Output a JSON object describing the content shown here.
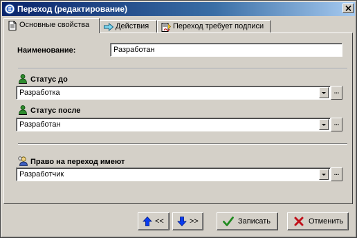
{
  "window": {
    "title": "Переход (редактирование)"
  },
  "tabs": [
    {
      "label": "Основные свойства",
      "icon": "document-icon",
      "active": true
    },
    {
      "label": "Действия",
      "icon": "arrow-right-icon",
      "active": false
    },
    {
      "label": "Переход требует подписи",
      "icon": "signature-icon",
      "active": false
    }
  ],
  "form": {
    "name_label": "Наименование:",
    "name_value": "Разработан",
    "status_before_label": "Статус до",
    "status_before_value": "Разработка",
    "status_after_label": "Статус после",
    "status_after_value": "Разработан",
    "rights_label": "Право на переход имеют",
    "rights_value": "Разработчик",
    "ellipsis": "..."
  },
  "buttons": {
    "prev_label": "<<",
    "next_label": ">>",
    "save_label": "Записать",
    "cancel_label": "Отменить"
  },
  "colors": {
    "titlebar_start": "#0a246a",
    "titlebar_end": "#a6caf0",
    "face": "#d4d0c8",
    "arrow_blue": "#0a3cf0",
    "check_green": "#1f8a1f",
    "cancel_red": "#c0101a"
  }
}
